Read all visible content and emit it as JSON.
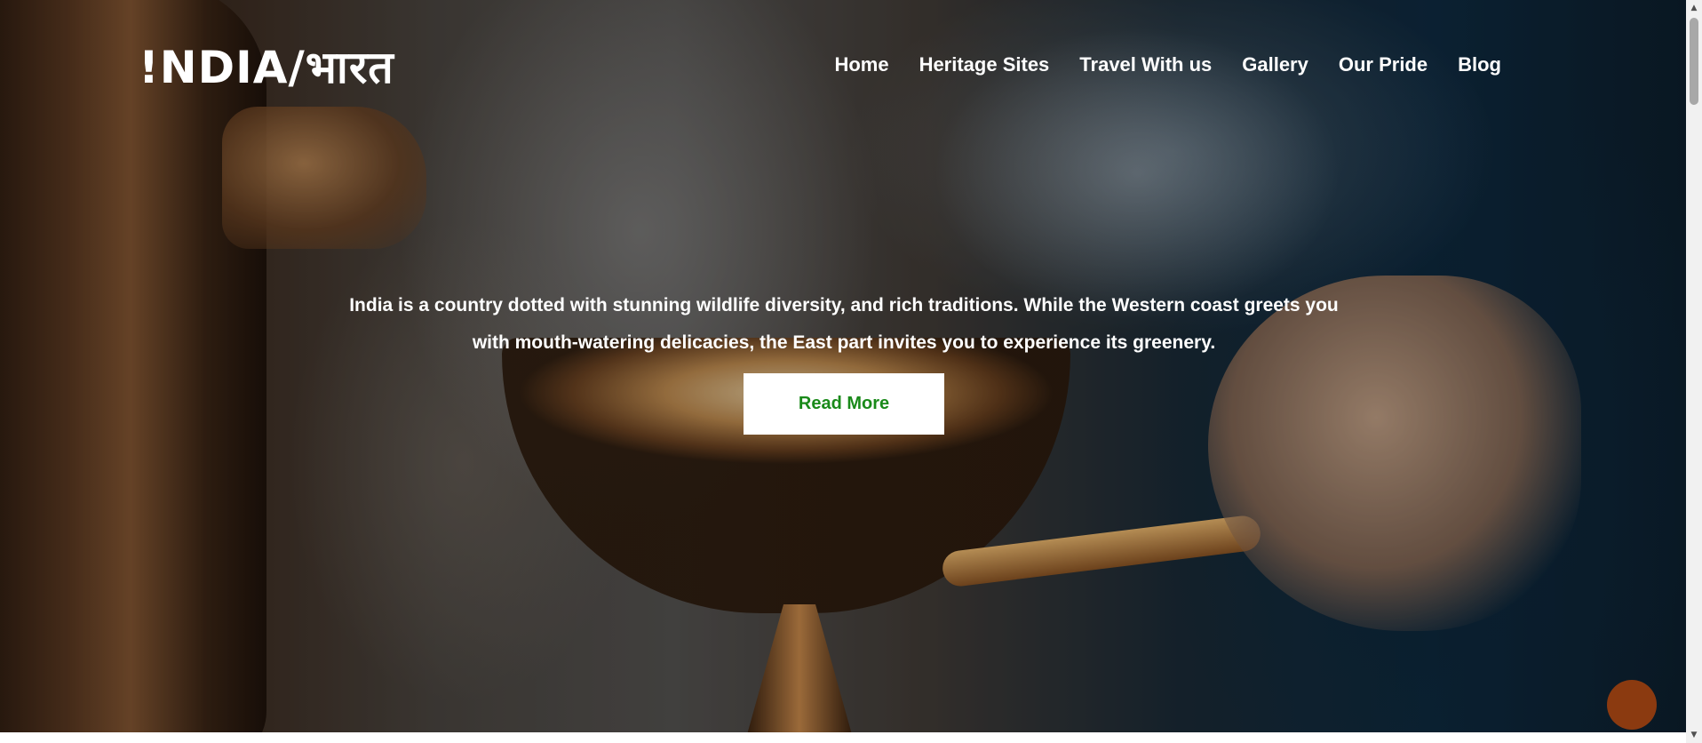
{
  "header": {
    "logo": "!NDIA/भारत",
    "nav": [
      {
        "label": "Home"
      },
      {
        "label": "Heritage Sites"
      },
      {
        "label": "Travel With us"
      },
      {
        "label": "Gallery"
      },
      {
        "label": "Our Pride"
      },
      {
        "label": "Blog"
      }
    ]
  },
  "hero": {
    "tagline": "India is a country dotted with stunning wildlife diversity, and rich traditions. While the Western coast greets you with mouth-watering delicacies, the East part invites you to experience its greenery.",
    "button_label": "Read More"
  },
  "colors": {
    "button_text": "#1a8a1a",
    "fab": "#8b3a10"
  },
  "scrollbar": {
    "up_arrow": "▲",
    "down_arrow": "▼"
  }
}
